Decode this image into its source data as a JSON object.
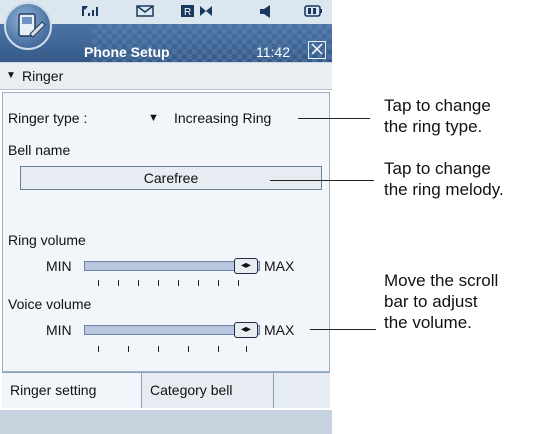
{
  "status_bar": {
    "icons": [
      "signal-icon",
      "message-icon",
      "roaming-icon",
      "bluetooth-icon",
      "volume-icon",
      "battery-icon"
    ]
  },
  "title_bar": {
    "title": "Phone Setup",
    "time": "11:42",
    "close_symbol": "☒"
  },
  "ringer_section": {
    "label": "Ringer"
  },
  "ringer_type": {
    "label": "Ringer type :",
    "value": "Increasing Ring"
  },
  "bell_name": {
    "label": "Bell name",
    "value": "Carefree"
  },
  "ring_volume": {
    "label": "Ring volume",
    "min_label": "MIN",
    "max_label": "MAX",
    "level": 1.0
  },
  "voice_volume": {
    "label": "Voice volume",
    "min_label": "MIN",
    "max_label": "MAX",
    "level": 1.0
  },
  "tabs": [
    {
      "label": "Ringer setting"
    },
    {
      "label": "Category bell"
    }
  ],
  "callouts": [
    {
      "text_line1": "Tap to change",
      "text_line2": "the ring type."
    },
    {
      "text_line1": "Tap to change",
      "text_line2": "the ring melody."
    },
    {
      "text_line1": "Move the scroll",
      "text_line2": "bar to adjust",
      "text_line3": "the volume."
    }
  ],
  "colors": {
    "title_bar": "#3f6696",
    "status_bar": "#dce6ee",
    "content_bg": "#f2f5f9",
    "track": "#b9c6e0"
  }
}
